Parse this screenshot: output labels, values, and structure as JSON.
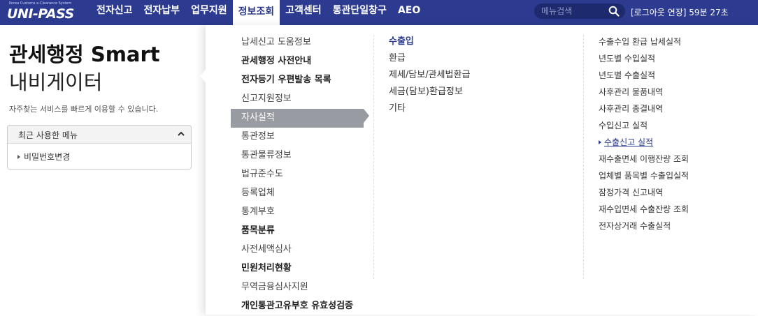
{
  "logo": {
    "sub": "Korea Customs e-Clearance System",
    "main": "UNI-PASS"
  },
  "nav": {
    "items": [
      "전자신고",
      "전자납부",
      "업무지원",
      "정보조회",
      "고객센터",
      "통관단일창구",
      "AEO"
    ],
    "active_index": 3
  },
  "search": {
    "placeholder": "메뉴검색"
  },
  "logout": {
    "label": "[로그아웃 연장] 59분 27초"
  },
  "left": {
    "title_line1": "관세행정 Smart",
    "title_line2": "내비게이터",
    "description": "자주찾는 서비스를 빠르게 이용할 수 있습니다.",
    "recent": {
      "title": "최근 사용한 메뉴",
      "items": [
        "비밀번호변경"
      ]
    }
  },
  "menu": {
    "col1": [
      {
        "label": "납세신고 도움정보",
        "bold": false
      },
      {
        "label": "관세행정 사전안내",
        "bold": true
      },
      {
        "label": "전자등기 우편발송 목록",
        "bold": true
      },
      {
        "label": "신고지원정보",
        "bold": false
      },
      {
        "label": "자사실적",
        "bold": false,
        "active": true
      },
      {
        "label": "통관정보",
        "bold": false
      },
      {
        "label": "통관물류정보",
        "bold": false
      },
      {
        "label": "법규준수도",
        "bold": false
      },
      {
        "label": "등록업체",
        "bold": false
      },
      {
        "label": "통계부호",
        "bold": false
      },
      {
        "label": "품목분류",
        "bold": true
      },
      {
        "label": "사전세액심사",
        "bold": false
      },
      {
        "label": "민원처리현황",
        "bold": true
      },
      {
        "label": "무역금융심사지원",
        "bold": false
      },
      {
        "label": "개인통관고유부호 유효성검증",
        "bold": true
      }
    ],
    "col2": [
      "수출입",
      "환급",
      "제세/담보/관세법환급",
      "세금(담보)환급정보",
      "기타"
    ],
    "col3": [
      "수출수입 환급 납세실적",
      "년도별 수입실적",
      "년도별 수출실적",
      "사후관리 물품내역",
      "사후관리 종결내역",
      "수입신고 실적",
      "수출신고 실적",
      "재수출면세 이행잔량 조회",
      "업체별 품목별 수출입실적",
      "잠정가격 신고내역",
      "재수입면세 수출잔량 조회",
      "전자상거래 수출실적"
    ],
    "col3_active_index": 6
  },
  "colors": {
    "brand": "#2c3b8f",
    "active_bg": "#999ba3"
  }
}
